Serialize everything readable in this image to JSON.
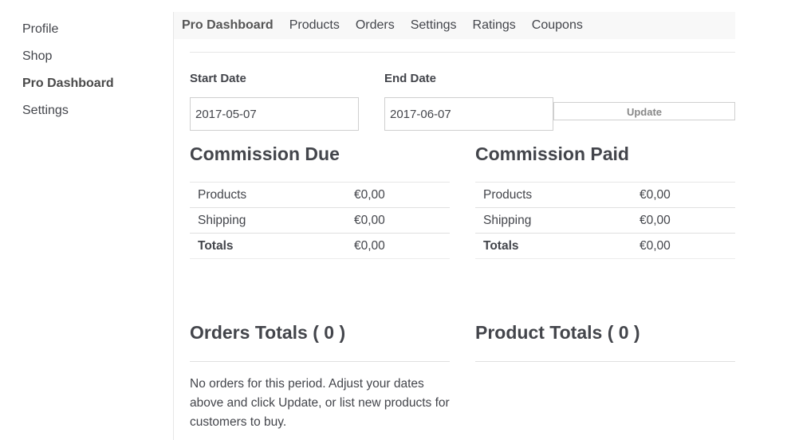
{
  "sidebar": {
    "items": [
      {
        "label": "Profile"
      },
      {
        "label": "Shop"
      },
      {
        "label": "Pro Dashboard"
      },
      {
        "label": "Settings"
      }
    ]
  },
  "tabs": [
    {
      "label": "Pro Dashboard"
    },
    {
      "label": "Products"
    },
    {
      "label": "Orders"
    },
    {
      "label": "Settings"
    },
    {
      "label": "Ratings"
    },
    {
      "label": "Coupons"
    }
  ],
  "filters": {
    "start_label": "Start Date",
    "start_value": "2017-05-07",
    "end_label": "End Date",
    "end_value": "2017-06-07",
    "update_label": "Update"
  },
  "commission_due": {
    "title": "Commission Due",
    "rows": [
      {
        "label": "Products",
        "value": "€0,00"
      },
      {
        "label": "Shipping",
        "value": "€0,00"
      },
      {
        "label": "Totals",
        "value": "€0,00"
      }
    ]
  },
  "commission_paid": {
    "title": "Commission Paid",
    "rows": [
      {
        "label": "Products",
        "value": "€0,00"
      },
      {
        "label": "Shipping",
        "value": "€0,00"
      },
      {
        "label": "Totals",
        "value": "€0,00"
      }
    ]
  },
  "orders_totals": {
    "title": "Orders Totals ( 0 )",
    "message": "No orders for this period. Adjust your dates above and click Update, or list new products for customers to buy."
  },
  "product_totals": {
    "title": "Product Totals ( 0 )"
  }
}
